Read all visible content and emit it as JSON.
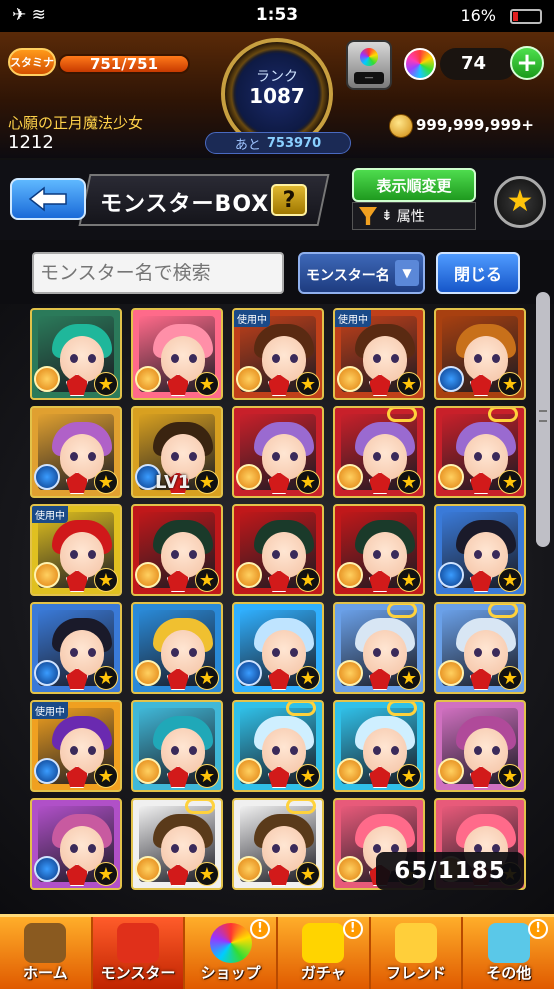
{
  "status_bar": {
    "time": "1:53",
    "battery": "16%"
  },
  "header": {
    "stamina_label": "スタミナ",
    "stamina_value": "751/751",
    "rank_label": "ランク",
    "rank_value": "1087",
    "remain_label": "あと",
    "remain_value": "753970",
    "orb_count": "74",
    "username": "心願の正月魔法少女",
    "user_id": "1212",
    "coins": "999,999,999+"
  },
  "titlebar": {
    "title": "モンスターBOX",
    "help": "?",
    "sort_button": "表示順変更",
    "filter_label": "属性"
  },
  "search": {
    "placeholder": "モンスター名で検索",
    "select_value": "モンスター名",
    "close_label": "閉じる"
  },
  "box": {
    "level_label": "LV1",
    "count": "65/1185",
    "tags": [
      "使用中",
      "使用中",
      "使用中",
      "使用中"
    ],
    "monsters": [
      {
        "hair": "#1fb79b",
        "bg": "#2b7a5a",
        "el": "fire"
      },
      {
        "hair": "#ff8fa8",
        "bg": "#ff6a8a",
        "el": "fire"
      },
      {
        "hair": "#5a2a12",
        "bg": "#c0401a",
        "el": "fire"
      },
      {
        "hair": "#5a2a12",
        "bg": "#c0401a",
        "el": "fire"
      },
      {
        "hair": "#c8701a",
        "bg": "#a84010",
        "el": "water"
      },
      {
        "hair": "#b061c8",
        "bg": "#e0a030",
        "el": "water"
      },
      {
        "hair": "#3a2410",
        "bg": "#d8a020",
        "el": "water"
      },
      {
        "hair": "#9a6ad0",
        "bg": "#c8202a",
        "el": "fire"
      },
      {
        "hair": "#9a6ad0",
        "bg": "#c8202a",
        "el": "fire"
      },
      {
        "hair": "#9a6ad0",
        "bg": "#c8202a",
        "el": "fire"
      },
      {
        "hair": "#d0181a",
        "bg": "#e0c020",
        "el": "fire"
      },
      {
        "hair": "#1a3a2a",
        "bg": "#c0181a",
        "el": "fire"
      },
      {
        "hair": "#1a3a2a",
        "bg": "#c0181a",
        "el": "fire"
      },
      {
        "hair": "#1a3a2a",
        "bg": "#c0181a",
        "el": "fire"
      },
      {
        "hair": "#1a1a2a",
        "bg": "#3a7ad8",
        "el": "water"
      },
      {
        "hair": "#1a1a2a",
        "bg": "#3a7ad8",
        "el": "water"
      },
      {
        "hair": "#f0c030",
        "bg": "#2a8ad8",
        "el": "fire"
      },
      {
        "hair": "#bfe4ff",
        "bg": "#30b0ff",
        "el": "water"
      },
      {
        "hair": "#d8e6f4",
        "bg": "#6aa0e8",
        "el": "fire"
      },
      {
        "hair": "#d8e6f4",
        "bg": "#6aa0e8",
        "el": "fire"
      },
      {
        "hair": "#6a2ab0",
        "bg": "#f0a020",
        "el": "water"
      },
      {
        "hair": "#20a8b8",
        "bg": "#40b8d8",
        "el": "fire"
      },
      {
        "hair": "#cfefff",
        "bg": "#30c0e8",
        "el": "fire"
      },
      {
        "hair": "#cfefff",
        "bg": "#30c0e8",
        "el": "fire"
      },
      {
        "hair": "#b04a9a",
        "bg": "#d070c0",
        "el": "fire"
      },
      {
        "hair": "#c85aa0",
        "bg": "#b050c8",
        "el": "water"
      },
      {
        "hair": "#5a3a1a",
        "bg": "#f0f0f0",
        "el": "fire"
      },
      {
        "hair": "#5a3a1a",
        "bg": "#f0f0f0",
        "el": "fire"
      },
      {
        "hair": "#ff6a8a",
        "bg": "#e85a7a",
        "el": "fire"
      },
      {
        "hair": "#ff6a8a",
        "bg": "#e85a7a",
        "el": "fire"
      }
    ]
  },
  "bottom_nav": [
    {
      "label": "ホーム",
      "icon": "home-icon",
      "badge": ""
    },
    {
      "label": "モンスター",
      "icon": "monster-icon",
      "badge": ""
    },
    {
      "label": "ショップ",
      "icon": "orb-shop-icon",
      "badge": "!"
    },
    {
      "label": "ガチャ",
      "icon": "gacha-egg-icon",
      "badge": "!"
    },
    {
      "label": "フレンド",
      "icon": "friend-icon",
      "badge": ""
    },
    {
      "label": "その他",
      "icon": "question-box-icon",
      "badge": "!"
    }
  ],
  "colors": {
    "accent": "#ff8a1a",
    "nav_active": "#e03a10",
    "button_blue": "#1e6ae0",
    "button_green": "#2fb52f"
  }
}
